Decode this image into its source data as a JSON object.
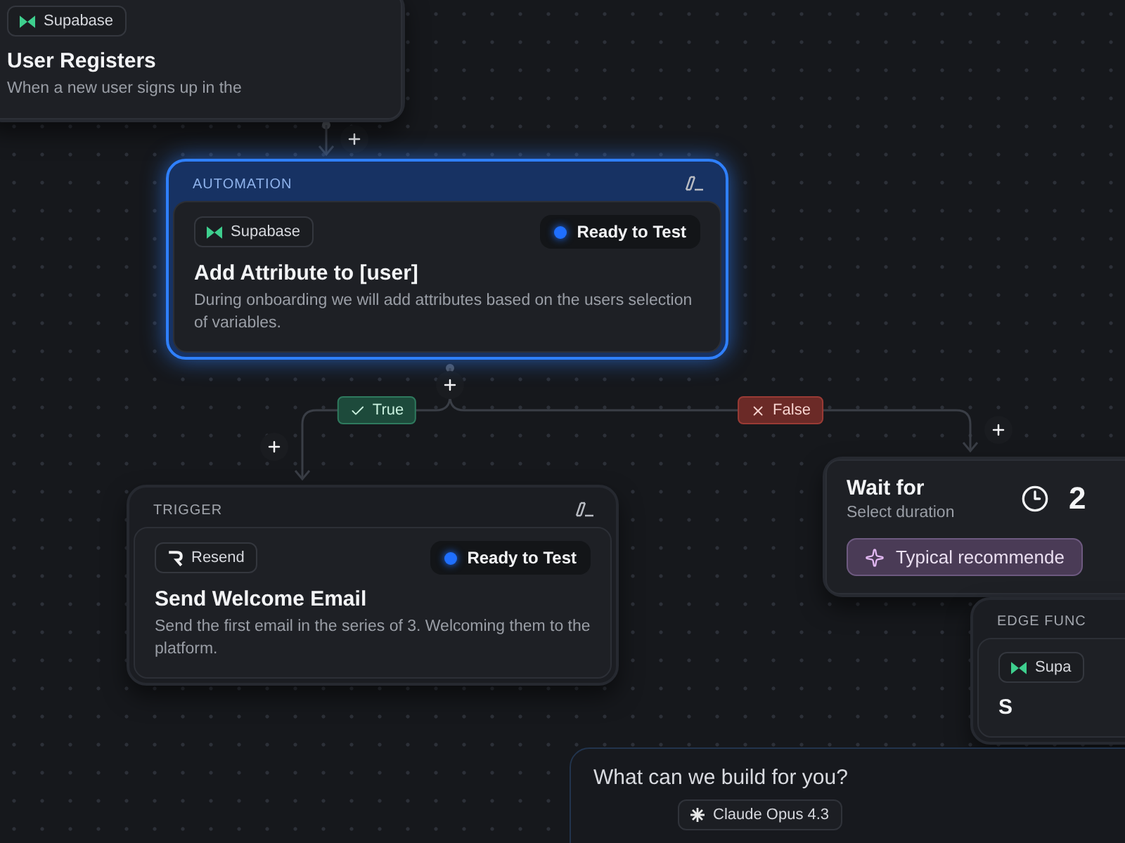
{
  "nodes": [
    {
      "kind": "step",
      "selected": false,
      "app": {
        "name": "Supabase",
        "kind": "supabase"
      },
      "title": "User Registers",
      "description": "When a new user signs up in the"
    },
    {
      "kind": "step",
      "selected": true,
      "label": "AUTOMATION",
      "status": "Ready to Test",
      "app": {
        "name": "Supabase",
        "kind": "supabase"
      },
      "title": "Add Attribute to [user]",
      "description": "During onboarding we will add attributes based on the users selection of variables."
    },
    {
      "kind": "wait",
      "title": "Wait for",
      "subtitle": "Select duration",
      "value": "2",
      "hint": "Typical recommende"
    },
    {
      "kind": "step",
      "selected": false,
      "label": "TRIGGER",
      "status": "Ready to Test",
      "app": {
        "name": "Resend",
        "kind": "resend"
      },
      "title": "Send Welcome Email",
      "description": "Send the first email in the series of 3. Welcoming them to the platform."
    },
    {
      "kind": "step",
      "selected": false,
      "label": "EDGE FUNC",
      "app": {
        "name": "Supa",
        "kind": "supabase"
      },
      "title": "S"
    }
  ],
  "branches": [
    {
      "kind": "true",
      "label": "True"
    },
    {
      "kind": "false",
      "label": "False"
    }
  ],
  "prompt": {
    "placeholder": "What can we build for you?",
    "model": "Claude Opus 4.3"
  }
}
